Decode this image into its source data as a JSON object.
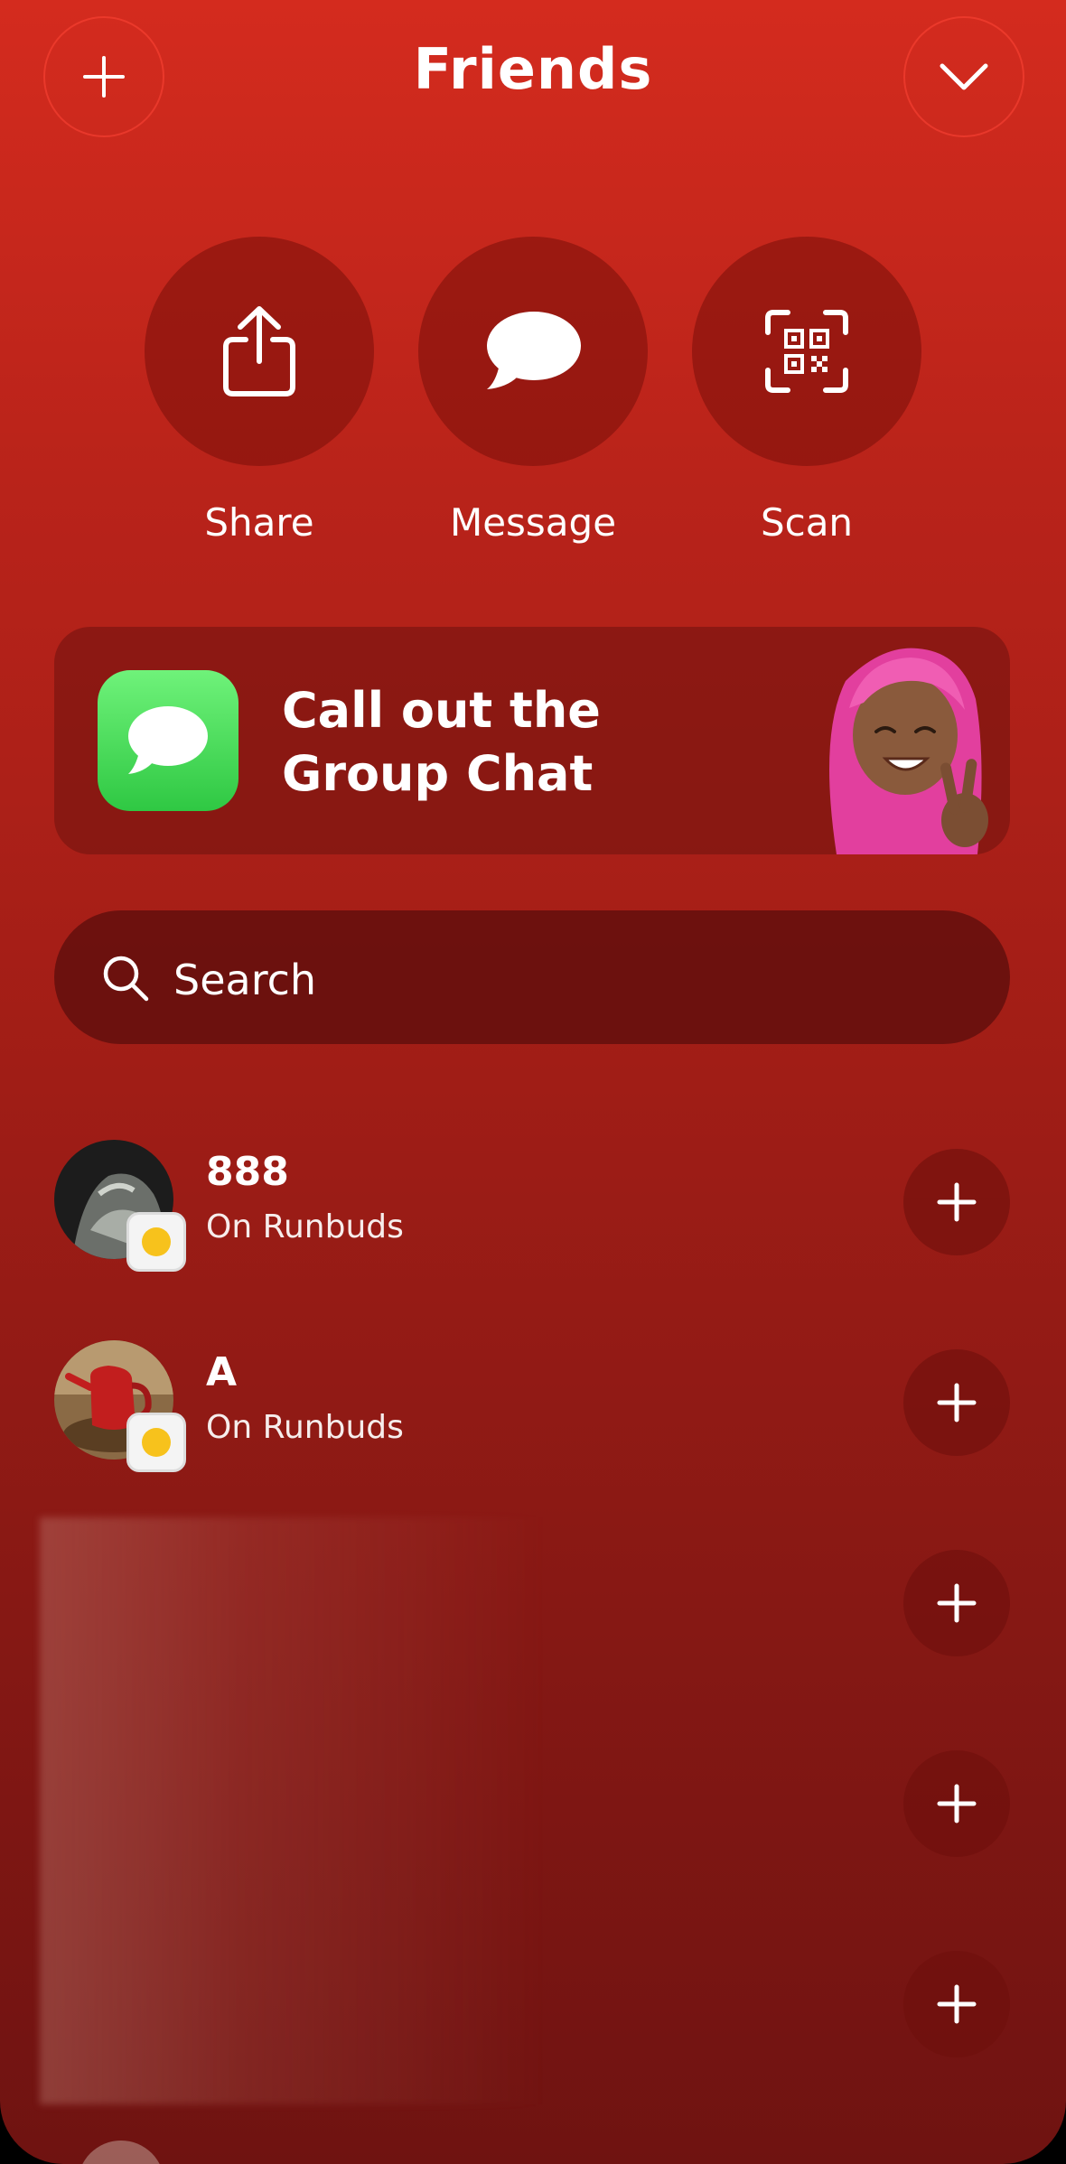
{
  "header": {
    "title": "Friends",
    "left_button_icon": "plus-icon",
    "right_button_icon": "chevron-down-icon"
  },
  "actions": [
    {
      "label": "Share",
      "icon": "share-icon"
    },
    {
      "label": "Message",
      "icon": "speech-bubble-icon"
    },
    {
      "label": "Scan",
      "icon": "qr-scan-icon"
    }
  ],
  "banner": {
    "text": "Call out the Group Chat",
    "icon": "messages-app-icon",
    "image": "memoji-peace-sign"
  },
  "search": {
    "label": "Search",
    "icon": "search-icon"
  },
  "friends": [
    {
      "name": "888",
      "status": "On Runbuds"
    },
    {
      "name": "A",
      "status": "On Runbuds"
    }
  ],
  "colors": {
    "background_top": "#d42b1e",
    "background_bottom": "#6f1311",
    "message_app_green": "#2fc843",
    "badge_face": "#f7c21c"
  }
}
